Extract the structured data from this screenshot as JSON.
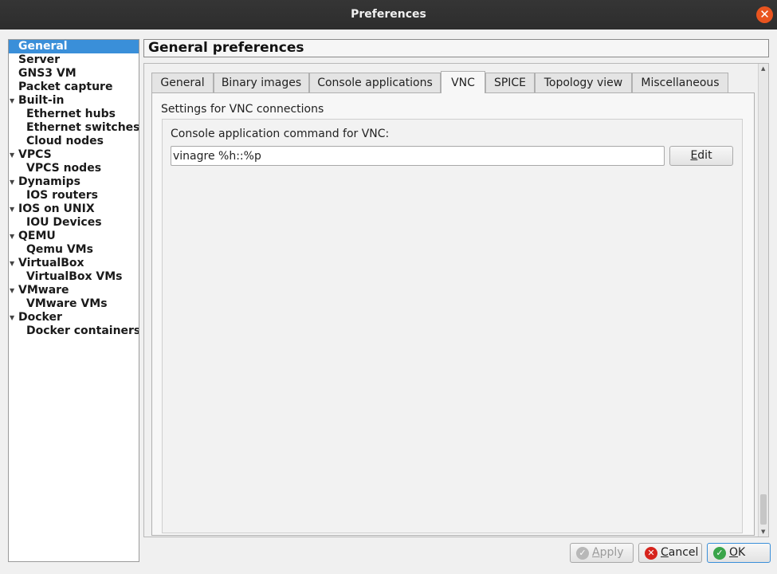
{
  "window": {
    "title": "Preferences",
    "close_glyph": "✕"
  },
  "sidebar": {
    "items": [
      {
        "label": "General",
        "level": 0,
        "expandable": false,
        "selected": true
      },
      {
        "label": "Server",
        "level": 0,
        "expandable": false
      },
      {
        "label": "GNS3 VM",
        "level": 0,
        "expandable": false
      },
      {
        "label": "Packet capture",
        "level": 0,
        "expandable": false
      },
      {
        "label": "Built-in",
        "level": 0,
        "expandable": true
      },
      {
        "label": "Ethernet hubs",
        "level": 1
      },
      {
        "label": "Ethernet switches",
        "level": 1
      },
      {
        "label": "Cloud nodes",
        "level": 1
      },
      {
        "label": "VPCS",
        "level": 0,
        "expandable": true
      },
      {
        "label": "VPCS nodes",
        "level": 1
      },
      {
        "label": "Dynamips",
        "level": 0,
        "expandable": true
      },
      {
        "label": "IOS routers",
        "level": 1
      },
      {
        "label": "IOS on UNIX",
        "level": 0,
        "expandable": true
      },
      {
        "label": "IOU Devices",
        "level": 1
      },
      {
        "label": "QEMU",
        "level": 0,
        "expandable": true
      },
      {
        "label": "Qemu VMs",
        "level": 1
      },
      {
        "label": "VirtualBox",
        "level": 0,
        "expandable": true
      },
      {
        "label": "VirtualBox VMs",
        "level": 1
      },
      {
        "label": "VMware",
        "level": 0,
        "expandable": true
      },
      {
        "label": "VMware VMs",
        "level": 1
      },
      {
        "label": "Docker",
        "level": 0,
        "expandable": true
      },
      {
        "label": "Docker containers",
        "level": 1
      }
    ]
  },
  "main": {
    "header": "General preferences",
    "tabs": [
      {
        "label": "General"
      },
      {
        "label": "Binary images"
      },
      {
        "label": "Console applications"
      },
      {
        "label": "VNC",
        "active": true
      },
      {
        "label": "SPICE"
      },
      {
        "label": "Topology view"
      },
      {
        "label": "Miscellaneous"
      }
    ],
    "vnc": {
      "pane_title": "Settings for VNC connections",
      "command_label": "Console application command for VNC:",
      "command_value": "vinagre %h::%p",
      "edit_label": "Edit"
    }
  },
  "buttons": {
    "apply_label": "Apply",
    "cancel_label": "Cancel",
    "ok_label": "OK",
    "apply_enabled": false
  },
  "colors": {
    "selection": "#3a8fd9",
    "close_button": "#e9541f",
    "ok_icon": "#3aa54a",
    "cancel_icon": "#d6231c"
  }
}
